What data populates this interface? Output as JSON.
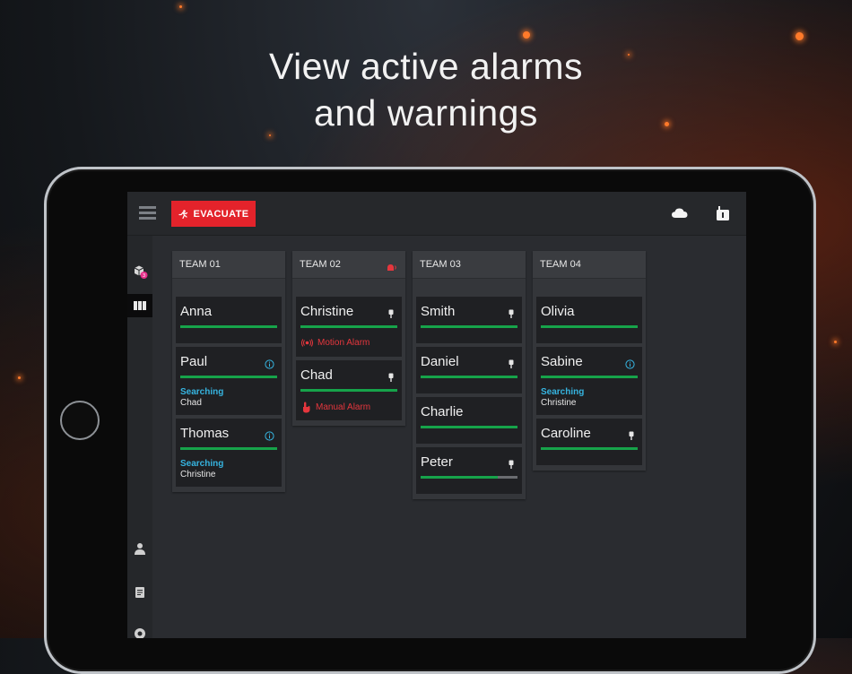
{
  "headline": {
    "line1": "View active alarms",
    "line2": "and warnings"
  },
  "topbar": {
    "evacuate_label": "EVACUATE",
    "icons": [
      "menu-icon",
      "evacuate-runner-icon",
      "cloud-icon",
      "radio-device-icon"
    ]
  },
  "sidebar": {
    "badge_count": "3",
    "icons": [
      "package-icon",
      "columns-icon",
      "person-icon",
      "document-icon",
      "settings-icon"
    ]
  },
  "colors": {
    "accent_red": "#e3232b",
    "progress_green": "#16a34a",
    "status_blue": "#36b4e0",
    "alarm_red": "#e5363d"
  },
  "teams": [
    {
      "title": "TEAM 01",
      "alert": false,
      "members": [
        {
          "name": "Anna",
          "icon": "",
          "progress": 1.0
        },
        {
          "name": "Paul",
          "icon": "info-icon",
          "progress": 1.0,
          "status": "Searching",
          "sub": "Chad"
        },
        {
          "name": "Thomas",
          "icon": "info-icon",
          "progress": 1.0,
          "status": "Searching",
          "sub": "Christine"
        }
      ]
    },
    {
      "title": "TEAM 02",
      "alert": true,
      "members": [
        {
          "name": "Christine",
          "icon": "device-icon",
          "progress": 1.0,
          "alarm": "Motion Alarm"
        },
        {
          "name": "Chad",
          "icon": "device-icon",
          "progress": 1.0,
          "alarm": "Manual Alarm"
        }
      ]
    },
    {
      "title": "TEAM 03",
      "alert": false,
      "members": [
        {
          "name": "Smith",
          "icon": "device-icon",
          "progress": 1.0
        },
        {
          "name": "Daniel",
          "icon": "device-icon",
          "progress": 1.0
        },
        {
          "name": "Charlie",
          "icon": "",
          "progress": 1.0
        },
        {
          "name": "Peter",
          "icon": "device-icon",
          "progress": 0.8
        }
      ]
    },
    {
      "title": "TEAM 04",
      "alert": false,
      "members": [
        {
          "name": "Olivia",
          "icon": "",
          "progress": 1.0
        },
        {
          "name": "Sabine",
          "icon": "info-icon",
          "progress": 1.0,
          "status": "Searching",
          "sub": "Christine"
        },
        {
          "name": "Caroline",
          "icon": "device-icon",
          "progress": 1.0
        }
      ]
    }
  ]
}
